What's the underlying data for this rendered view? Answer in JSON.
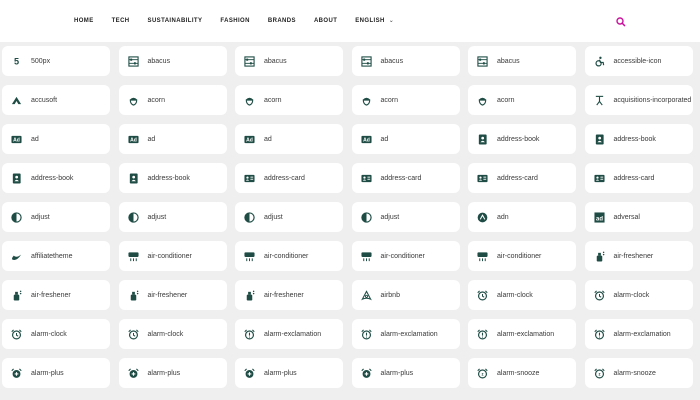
{
  "nav": {
    "items": [
      "HOME",
      "TECH",
      "SUSTAINABILITY",
      "FASHION",
      "BRANDS",
      "ABOUT"
    ],
    "language": "ENGLISH"
  },
  "colors": {
    "icon": "#1f4d45",
    "accent": "#c8109c",
    "card": "#ffffff",
    "page": "#efefef"
  },
  "icons": [
    {
      "label": "500px",
      "icon": "500px-icon"
    },
    {
      "label": "abacus",
      "icon": "abacus-icon"
    },
    {
      "label": "abacus",
      "icon": "abacus-icon"
    },
    {
      "label": "abacus",
      "icon": "abacus-icon"
    },
    {
      "label": "abacus",
      "icon": "abacus-icon"
    },
    {
      "label": "accessible-icon",
      "icon": "wheelchair-icon"
    },
    {
      "label": "accusoft",
      "icon": "accusoft-icon"
    },
    {
      "label": "acorn",
      "icon": "acorn-icon"
    },
    {
      "label": "acorn",
      "icon": "acorn-icon"
    },
    {
      "label": "acorn",
      "icon": "acorn-icon"
    },
    {
      "label": "acorn",
      "icon": "acorn-icon"
    },
    {
      "label": "acquisitions-incorporated",
      "icon": "acquisitions-incorporated-icon"
    },
    {
      "label": "ad",
      "icon": "ad-icon"
    },
    {
      "label": "ad",
      "icon": "ad-icon"
    },
    {
      "label": "ad",
      "icon": "ad-icon"
    },
    {
      "label": "ad",
      "icon": "ad-icon"
    },
    {
      "label": "address-book",
      "icon": "address-book-icon"
    },
    {
      "label": "address-book",
      "icon": "address-book-icon"
    },
    {
      "label": "address-book",
      "icon": "address-book-icon"
    },
    {
      "label": "address-book",
      "icon": "address-book-icon"
    },
    {
      "label": "address-card",
      "icon": "address-card-icon"
    },
    {
      "label": "address-card",
      "icon": "address-card-icon"
    },
    {
      "label": "address-card",
      "icon": "address-card-icon"
    },
    {
      "label": "address-card",
      "icon": "address-card-icon"
    },
    {
      "label": "adjust",
      "icon": "adjust-icon"
    },
    {
      "label": "adjust",
      "icon": "adjust-icon"
    },
    {
      "label": "adjust",
      "icon": "adjust-icon"
    },
    {
      "label": "adjust",
      "icon": "adjust-icon"
    },
    {
      "label": "adn",
      "icon": "adn-icon"
    },
    {
      "label": "adversal",
      "icon": "adversal-icon"
    },
    {
      "label": "affiliatetheme",
      "icon": "affiliatetheme-icon"
    },
    {
      "label": "air-conditioner",
      "icon": "air-conditioner-icon"
    },
    {
      "label": "air-conditioner",
      "icon": "air-conditioner-icon"
    },
    {
      "label": "air-conditioner",
      "icon": "air-conditioner-icon"
    },
    {
      "label": "air-conditioner",
      "icon": "air-conditioner-icon"
    },
    {
      "label": "air-freshener",
      "icon": "air-freshener-icon"
    },
    {
      "label": "air-freshener",
      "icon": "air-freshener-icon"
    },
    {
      "label": "air-freshener",
      "icon": "air-freshener-icon"
    },
    {
      "label": "air-freshener",
      "icon": "air-freshener-icon"
    },
    {
      "label": "airbnb",
      "icon": "airbnb-icon"
    },
    {
      "label": "alarm-clock",
      "icon": "alarm-clock-icon"
    },
    {
      "label": "alarm-clock",
      "icon": "alarm-clock-icon"
    },
    {
      "label": "alarm-clock",
      "icon": "alarm-clock-icon"
    },
    {
      "label": "alarm-clock",
      "icon": "alarm-clock-icon"
    },
    {
      "label": "alarm-exclamation",
      "icon": "alarm-exclamation-icon"
    },
    {
      "label": "alarm-exclamation",
      "icon": "alarm-exclamation-icon"
    },
    {
      "label": "alarm-exclamation",
      "icon": "alarm-exclamation-icon"
    },
    {
      "label": "alarm-exclamation",
      "icon": "alarm-exclamation-icon"
    },
    {
      "label": "alarm-plus",
      "icon": "alarm-plus-icon"
    },
    {
      "label": "alarm-plus",
      "icon": "alarm-plus-icon"
    },
    {
      "label": "alarm-plus",
      "icon": "alarm-plus-icon"
    },
    {
      "label": "alarm-plus",
      "icon": "alarm-plus-icon"
    },
    {
      "label": "alarm-snooze",
      "icon": "alarm-snooze-icon"
    },
    {
      "label": "alarm-snooze",
      "icon": "alarm-snooze-icon"
    }
  ]
}
